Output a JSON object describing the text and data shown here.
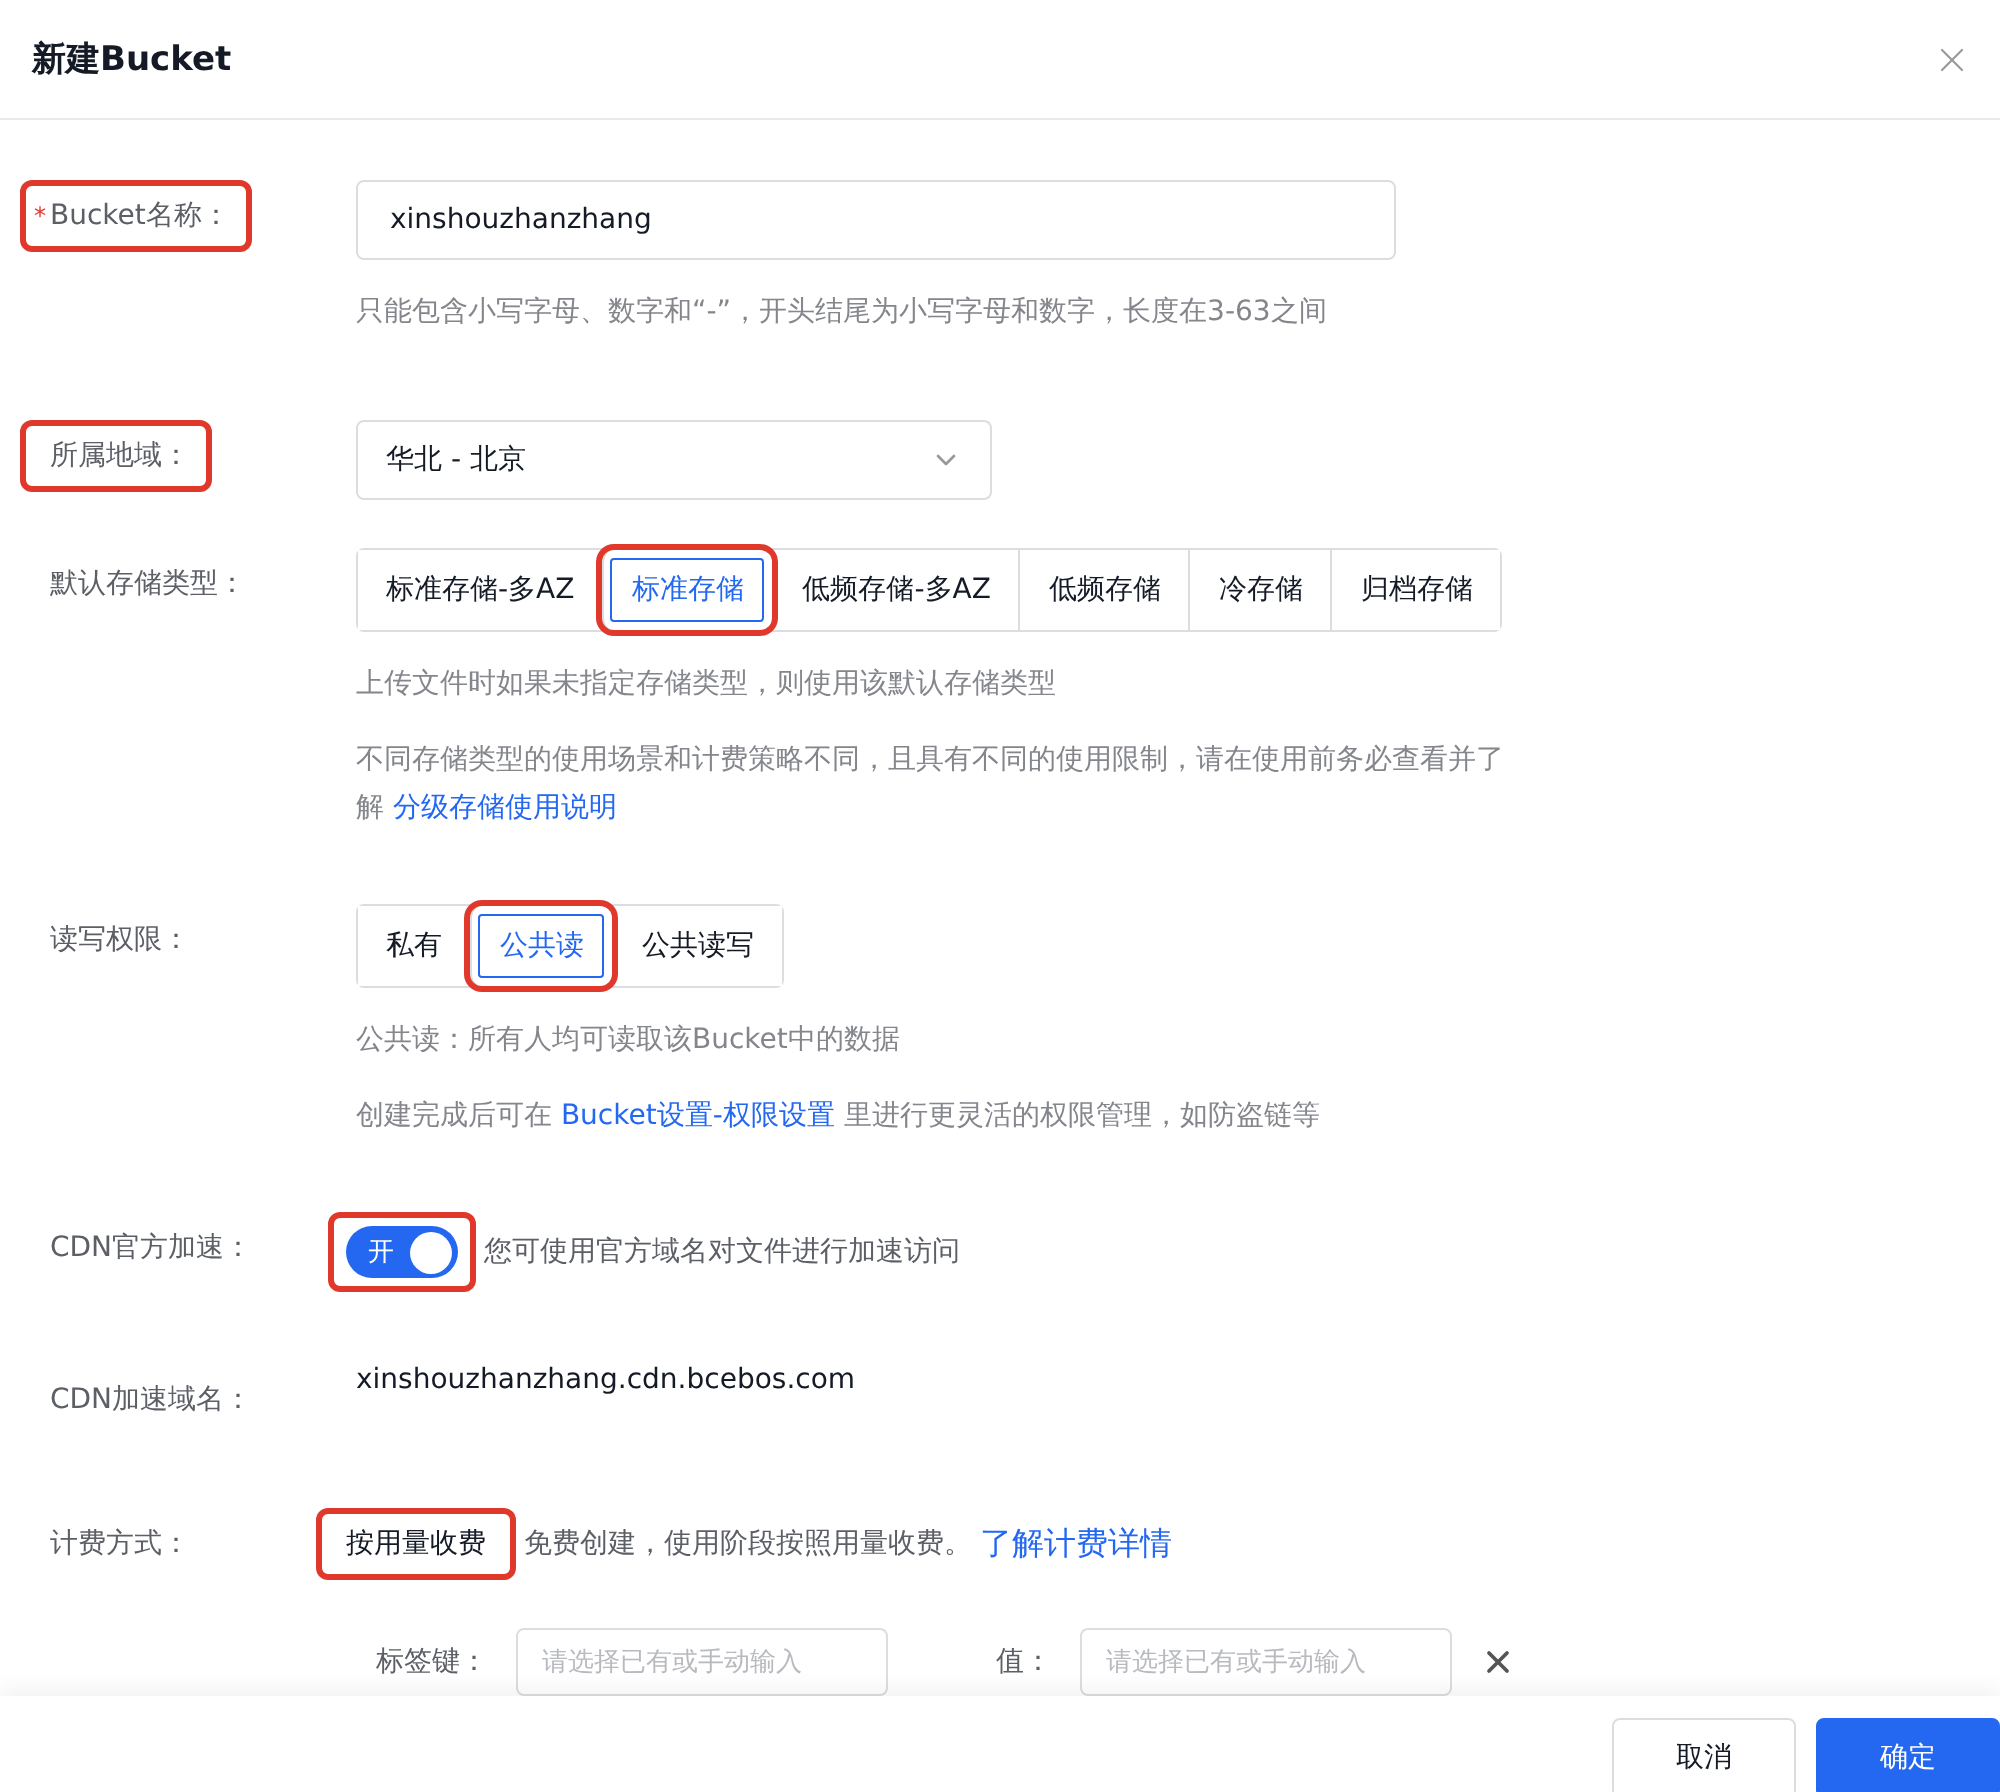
{
  "dialog": {
    "title": "新建Bucket"
  },
  "fields": [
    {
      "kind": "input",
      "label": "Bucket名称：",
      "required_mark": "*",
      "highlighted": true,
      "value": "xinshouzhanzhang",
      "hints": [
        [
          {
            "kind": "text",
            "text": "只能包含小写字母、数字和“-”，开头结尾为小写字母和数字，长度在3-63之间"
          }
        ]
      ]
    },
    {
      "kind": "select",
      "label": "所属地域：",
      "highlighted": true,
      "value": "华北 - 北京"
    },
    {
      "kind": "segmented",
      "label": "默认存储类型：",
      "options": [
        {
          "text": "标准存储-多AZ",
          "selected": false
        },
        {
          "text": "标准存储",
          "selected": true
        },
        {
          "text": "低频存储-多AZ",
          "selected": false
        },
        {
          "text": "低频存储",
          "selected": false
        },
        {
          "text": "冷存储",
          "selected": false
        },
        {
          "text": "归档存储",
          "selected": false
        }
      ],
      "hints": [
        [
          {
            "kind": "text",
            "text": "上传文件时如果未指定存储类型，则使用该默认存储类型"
          }
        ],
        [
          {
            "kind": "text",
            "text": "不同存储类型的使用场景和计费策略不同，且具有不同的使用限制，请在使用前务必查看并了解 "
          },
          {
            "kind": "link",
            "text": "分级存储使用说明"
          }
        ]
      ]
    },
    {
      "kind": "segmented",
      "label": "读写权限：",
      "options": [
        {
          "text": "私有",
          "selected": false
        },
        {
          "text": "公共读",
          "selected": true
        },
        {
          "text": "公共读写",
          "selected": false
        }
      ],
      "hints": [
        [
          {
            "kind": "text",
            "text": "公共读：所有人均可读取该Bucket中的数据"
          }
        ],
        [
          {
            "kind": "text",
            "text": "创建完成后可在 "
          },
          {
            "kind": "link",
            "text": "Bucket设置-权限设置"
          },
          {
            "kind": "text",
            "text": " 里进行更灵活的权限管理，如防盗链等"
          }
        ]
      ]
    },
    {
      "kind": "switch",
      "label": "CDN官方加速：",
      "highlighted": true,
      "on": true,
      "switch_text": "开",
      "description": "您可使用官方域名对文件进行加速访问"
    },
    {
      "kind": "text",
      "label": "CDN加速域名：",
      "value": "xinshouzhanzhang.cdn.bcebos.com"
    },
    {
      "kind": "billing",
      "label": "计费方式：",
      "highlighted": true,
      "value": "按用量收费",
      "description": "免费创建，使用阶段按照用量收费。",
      "link": "了解计费详情"
    }
  ],
  "tags": {
    "key_label": "标签键：",
    "key_placeholder": "请选择已有或手动输入",
    "value_label": "值：",
    "value_placeholder": "请选择已有或手动输入"
  },
  "buttons": [
    {
      "text": "取消",
      "kind": "secondary"
    },
    {
      "text": "确定",
      "kind": "primary"
    }
  ]
}
